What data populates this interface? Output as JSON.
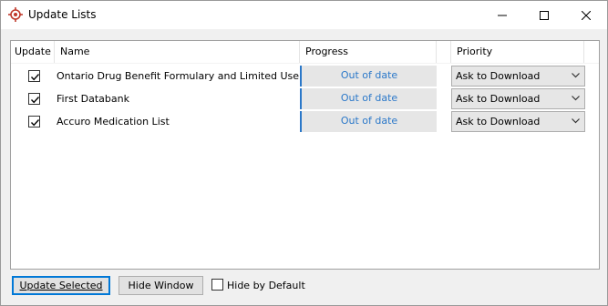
{
  "window": {
    "title": "Update Lists",
    "app_icon": "target-crosshair-icon"
  },
  "grid": {
    "columns": [
      "Update",
      "Name",
      "Progress",
      "",
      "Priority"
    ],
    "rows": [
      {
        "checked": true,
        "name": "Ontario Drug Benefit Formulary and Limited Use Codes",
        "progress": "Out of date",
        "priority": "Ask to Download"
      },
      {
        "checked": true,
        "name": "First Databank",
        "progress": "Out of date",
        "priority": "Ask to Download"
      },
      {
        "checked": true,
        "name": "Accuro Medication List",
        "progress": "Out of date",
        "priority": "Ask to Download"
      }
    ]
  },
  "footer": {
    "update_selected_label": "Update Selected",
    "hide_window_label": "Hide Window",
    "hide_by_default_label": "Hide by Default",
    "hide_by_default_checked": false
  },
  "colors": {
    "progress_accent": "#2b78c9",
    "focus_border": "#0078d7",
    "app_icon": "#c0392b"
  }
}
